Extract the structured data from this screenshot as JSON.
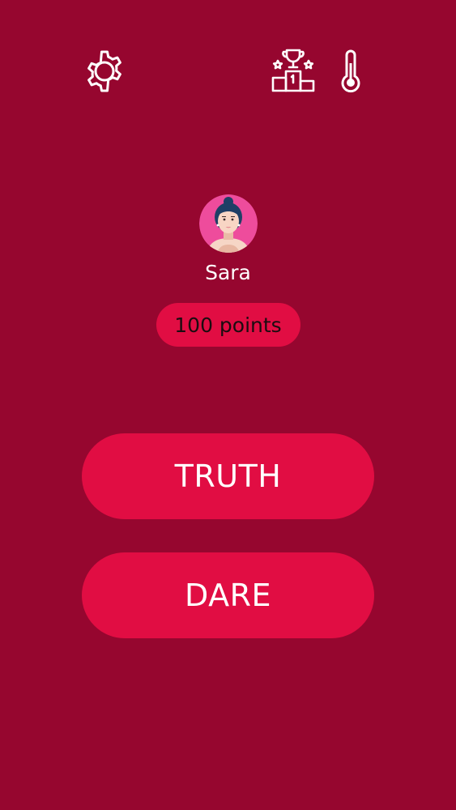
{
  "colors": {
    "background": "#96062F",
    "accent": "#E10D43",
    "icon": "#FFFFFF",
    "avatar_bg": "#EE4C9C"
  },
  "toolbar": {
    "settings_icon": "gear-icon",
    "leaderboard_icon": "trophy-podium-icon",
    "intensity_icon": "thermometer-icon"
  },
  "player": {
    "avatar_icon": "woman-avatar",
    "name": "Sara",
    "points": "100 points"
  },
  "actions": {
    "truth_label": "TRUTH",
    "dare_label": "DARE"
  }
}
